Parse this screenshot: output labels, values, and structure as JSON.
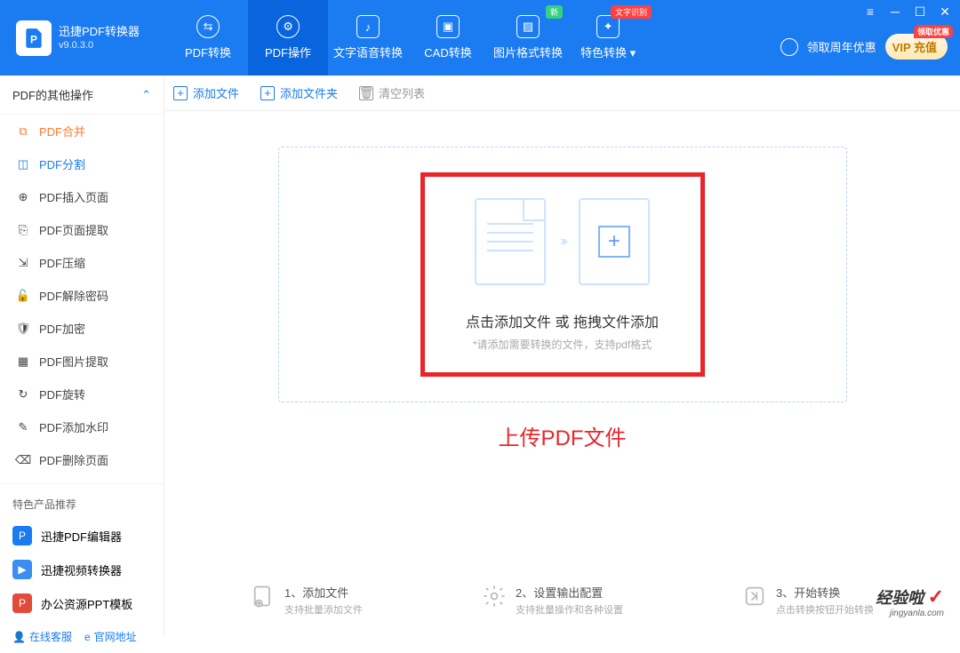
{
  "app": {
    "title": "迅捷PDF转换器",
    "version": "v9.0.3.0"
  },
  "tabs": [
    {
      "label": "PDF转换"
    },
    {
      "label": "PDF操作"
    },
    {
      "label": "文字语音转换"
    },
    {
      "label": "CAD转换"
    },
    {
      "label": "图片格式转换",
      "badge": "新"
    },
    {
      "label": "特色转换",
      "badge": "文字识别",
      "badge_red": true,
      "dropdown": true
    }
  ],
  "header_right": {
    "promo": "领取周年优惠",
    "vip": "VIP 充值",
    "vip_tag": "领取优惠"
  },
  "sidebar": {
    "section": "PDF的其他操作",
    "items": [
      {
        "label": "PDF合并"
      },
      {
        "label": "PDF分割"
      },
      {
        "label": "PDF插入页面"
      },
      {
        "label": "PDF页面提取"
      },
      {
        "label": "PDF压缩"
      },
      {
        "label": "PDF解除密码"
      },
      {
        "label": "PDF加密"
      },
      {
        "label": "PDF图片提取"
      },
      {
        "label": "PDF旋转"
      },
      {
        "label": "PDF添加水印"
      },
      {
        "label": "PDF删除页面"
      }
    ],
    "recommend_title": "特色产品推荐",
    "recommend": [
      {
        "label": "迅捷PDF编辑器",
        "color": "#1b7bf1"
      },
      {
        "label": "迅捷视频转换器",
        "color": "#ff8a3d"
      },
      {
        "label": "办公资源PPT模板",
        "color": "#e24b3b"
      }
    ],
    "bottom": {
      "support": "在线客服",
      "site": "官网地址"
    }
  },
  "toolbar": {
    "add_file": "添加文件",
    "add_folder": "添加文件夹",
    "clear": "清空列表"
  },
  "dropzone": {
    "title": "点击添加文件 或 拖拽文件添加",
    "subtitle": "*请添加需要转换的文件，支持pdf格式",
    "annotation": "上传PDF文件"
  },
  "steps": [
    {
      "title": "1、添加文件",
      "sub": "支持批量添加文件"
    },
    {
      "title": "2、设置输出配置",
      "sub": "支持批量操作和各种设置"
    },
    {
      "title": "3、开始转换",
      "sub": "点击转换按钮开始转换"
    }
  ],
  "watermark": {
    "brand": "经验啦",
    "url": "jingyanla.com"
  }
}
